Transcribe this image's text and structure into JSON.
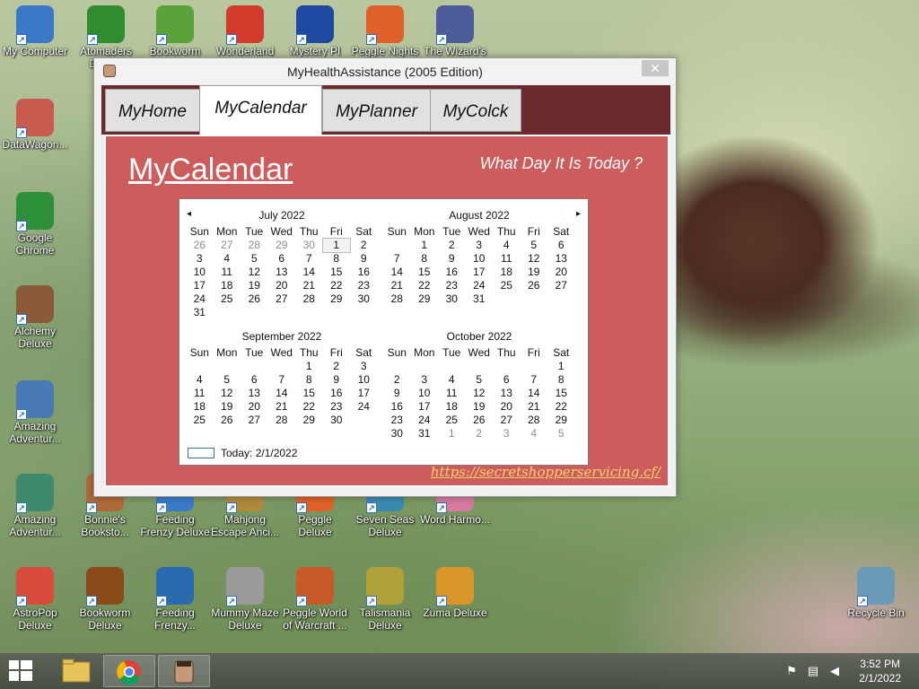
{
  "desktop": {
    "icons": [
      {
        "label": "My Computer",
        "icon": "computer-icon",
        "color": "#3a78c8"
      },
      {
        "label": "Atomaders Deluxe",
        "icon": "radioactive-icon",
        "color": "#2f8c2f"
      },
      {
        "label": "Bookworm Deluxe",
        "icon": "bookworm-icon",
        "color": "#5aa33a"
      },
      {
        "label": "Wonderland Deluxe",
        "icon": "gnome-icon",
        "color": "#d03b2b"
      },
      {
        "label": "Mystery PI",
        "icon": "mpi-icon",
        "color": "#1d4aa0"
      },
      {
        "label": "Peggle Nights",
        "icon": "peggle-icon",
        "color": "#e0602a"
      },
      {
        "label": "The Wizard's Pen",
        "icon": "wizard-icon",
        "color": "#4c5b9a"
      },
      {
        "label": "DataWagon...",
        "icon": "datawagon-icon",
        "color": "#c85a50"
      },
      {
        "label": "Google Chrome",
        "icon": "chrome-icon",
        "color": "#2d8f3a"
      },
      {
        "label": "Alchemy Deluxe",
        "icon": "alchemy-icon",
        "color": "#8a5a3a"
      },
      {
        "label": "Amazing Adventur...",
        "icon": "amazing-adventures-icon",
        "color": "#4a7ab5"
      },
      {
        "label": "Amazing Adventur...",
        "icon": "amazing-adventures-2-icon",
        "color": "#3f8a6a"
      },
      {
        "label": "AstroPop Deluxe",
        "icon": "astropop-icon",
        "color": "#d94b3a"
      },
      {
        "label": "Bonnie's Booksto...",
        "icon": "bonnies-bookstore-icon",
        "color": "#b06a3a"
      },
      {
        "label": "Bookworm Deluxe",
        "icon": "bookworm-2-icon",
        "color": "#8a4a1a"
      },
      {
        "label": "Feeding Frenzy Deluxe",
        "icon": "feeding-frenzy-icon",
        "color": "#3a7ac8"
      },
      {
        "label": "Feeding Frenzy...",
        "icon": "feeding-frenzy-2-icon",
        "color": "#2a6ab0"
      },
      {
        "label": "Mahjong Escape Anci...",
        "icon": "mahjong-icon",
        "color": "#b08a3a"
      },
      {
        "label": "Mummy Maze Deluxe",
        "icon": "mummy-icon",
        "color": "#9a9a9a"
      },
      {
        "label": "Peggle Deluxe",
        "icon": "peggle-2-icon",
        "color": "#e0602a"
      },
      {
        "label": "Peggle World of Warcraft ...",
        "icon": "peggle-wow-icon",
        "color": "#c85a2a"
      },
      {
        "label": "Seven Seas Deluxe",
        "icon": "seven-seas-icon",
        "color": "#3a8ab0"
      },
      {
        "label": "Talismania Deluxe",
        "icon": "talismania-icon",
        "color": "#b0a03a"
      },
      {
        "label": "Word Harmo...",
        "icon": "word-harmony-icon",
        "color": "#d87aa0"
      },
      {
        "label": "Zuma Deluxe",
        "icon": "zuma-icon",
        "color": "#d8962a"
      },
      {
        "label": "Recycle Bin",
        "icon": "recycle-bin-icon",
        "color": "#6a9ab8"
      }
    ]
  },
  "window": {
    "title": "MyHealthAssistance (2005 Edition)",
    "close": "✕",
    "tabs": [
      "MyHome",
      "MyCalendar",
      "MyPlanner",
      "MyColck"
    ],
    "active_tab": "MyCalendar",
    "panel_title": "MyCalendar",
    "panel_subtitle": "What Day It Is Today ?",
    "footer_link": "https://secretshopperservicing.cf/",
    "colors": {
      "tab_strip": "#6b2b2e",
      "panel": "#cd5c5c",
      "link": "#ffd36b"
    }
  },
  "calendar": {
    "weekdays": [
      "Sun",
      "Mon",
      "Tue",
      "Wed",
      "Thu",
      "Fri",
      "Sat"
    ],
    "prev_arrow": "◂",
    "next_arrow": "▸",
    "months": [
      {
        "title": "July 2022",
        "days": [
          "26",
          "27",
          "28",
          "29",
          "30",
          "1",
          "2",
          "3",
          "4",
          "5",
          "6",
          "7",
          "8",
          "9",
          "10",
          "11",
          "12",
          "13",
          "14",
          "15",
          "16",
          "17",
          "18",
          "19",
          "20",
          "21",
          "22",
          "23",
          "24",
          "25",
          "26",
          "27",
          "28",
          "29",
          "30",
          "31"
        ],
        "dim_leading": 5,
        "dim_trailing": 0
      },
      {
        "title": "August 2022",
        "days": [
          "",
          "1",
          "2",
          "3",
          "4",
          "5",
          "6",
          "7",
          "8",
          "9",
          "10",
          "11",
          "12",
          "13",
          "14",
          "15",
          "16",
          "17",
          "18",
          "19",
          "20",
          "21",
          "22",
          "23",
          "24",
          "25",
          "26",
          "27",
          "28",
          "29",
          "30",
          "31"
        ],
        "dim_leading": 0,
        "dim_trailing": 0
      },
      {
        "title": "September 2022",
        "days": [
          "",
          "",
          "",
          "",
          "1",
          "2",
          "3",
          "4",
          "5",
          "6",
          "7",
          "8",
          "9",
          "10",
          "11",
          "12",
          "13",
          "14",
          "15",
          "16",
          "17",
          "18",
          "19",
          "20",
          "21",
          "22",
          "23",
          "24",
          "25",
          "26",
          "27",
          "28",
          "29",
          "30"
        ],
        "dim_leading": 0,
        "dim_trailing": 0
      },
      {
        "title": "October 2022",
        "days": [
          "",
          "",
          "",
          "",
          "",
          "",
          "1",
          "2",
          "3",
          "4",
          "5",
          "6",
          "7",
          "8",
          "9",
          "10",
          "11",
          "12",
          "13",
          "14",
          "15",
          "16",
          "17",
          "18",
          "19",
          "20",
          "21",
          "22",
          "23",
          "24",
          "25",
          "26",
          "27",
          "28",
          "29",
          "30",
          "31",
          "1",
          "2",
          "3",
          "4",
          "5"
        ],
        "dim_leading": 0,
        "dim_trailing": 5
      }
    ],
    "highlighted_day": "1",
    "today_label": "Today: 2/1/2022"
  },
  "taskbar": {
    "clock_time": "3:52 PM",
    "clock_date": "2/1/2022",
    "pinned": [
      "file-explorer-icon",
      "chrome-icon",
      "myhealthassistance-icon"
    ]
  }
}
